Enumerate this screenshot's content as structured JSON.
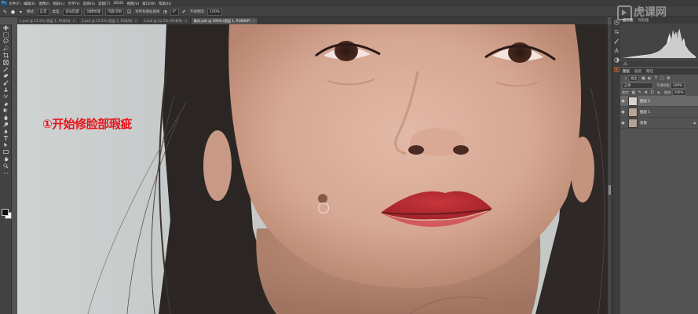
{
  "app": {
    "logo": "Ps",
    "menu": [
      "文件(F)",
      "编辑(E)",
      "图像(I)",
      "图层(L)",
      "文字(Y)",
      "选择(S)",
      "滤镜(T)",
      "3D(D)",
      "视图(V)",
      "窗口(W)",
      "帮助(H)"
    ]
  },
  "options_bar": {
    "mode_label": "模式:",
    "mode_value": "正常",
    "type_label": "类型:",
    "type_options": [
      "近似匹配",
      "创建纹理",
      "内容识别"
    ],
    "sample_label": "对所有图层取样",
    "angle_value": "0°",
    "opacity_label": "不透明度:",
    "opacity_value": "100%"
  },
  "tabs": [
    {
      "label": "1.psd @ 12.5% (图层 1, RGB/8)",
      "active": false
    },
    {
      "label": "2.psd @ 12.5% (图层 1, RGB/8)",
      "active": false
    },
    {
      "label": "3.psd @ 12.5% (RGB/8)",
      "active": false
    },
    {
      "label": "素材.psb @ 300% (图层 1, RGB/8#)",
      "active": true
    }
  ],
  "annotation": "①开始修脸部瑕疵",
  "watermark": "虎课网",
  "panels": {
    "histogram_tabs": [
      "直方图",
      "导航器"
    ],
    "layers_tabs": [
      "图层",
      "通道",
      "路径"
    ],
    "kind_label": "类型",
    "blend_mode": "正常",
    "opacity_label": "不透明度:",
    "opacity_value": "100%",
    "lock_label": "锁定:",
    "fill_label": "填充:",
    "fill_value": "100%",
    "layers": [
      {
        "name": "图层 2",
        "selected": true,
        "thumb_color": "#d9d3cf"
      },
      {
        "name": "图层 1",
        "selected": false,
        "thumb_color": "#b9a596"
      },
      {
        "name": "背景",
        "selected": false,
        "thumb_color": "#b3a293",
        "locked": true
      }
    ]
  },
  "colors": {
    "accent": "#31a8ff",
    "annotation": "#e8141a",
    "foreground": "#111111",
    "background": "#ffffff"
  }
}
